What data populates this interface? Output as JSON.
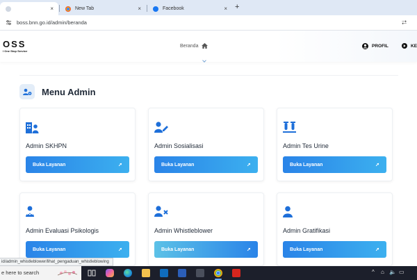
{
  "browser": {
    "tabs": [
      {
        "label": "",
        "close": "×"
      },
      {
        "label": "New Tab",
        "close": "×"
      },
      {
        "label": "Facebook",
        "close": "×"
      }
    ],
    "new_tab": "+",
    "url": "boss.bnn.go.id/admin/beranda"
  },
  "site": {
    "logo": "OSS",
    "logo_sub": "l One Stop Service",
    "nav": {
      "beranda": "Beranda",
      "profil": "PROFIL",
      "keluar": "KE"
    }
  },
  "menu": {
    "title": "Menu Admin",
    "cards": [
      {
        "title": "Admin SKHPN",
        "button": "Buka Layanan",
        "icon": "building-users-icon"
      },
      {
        "title": "Admin Sosialisasi",
        "button": "Buka Layanan",
        "icon": "user-edit-icon"
      },
      {
        "title": "Admin Tes Urine",
        "button": "Buka Layanan",
        "icon": "vials-icon"
      },
      {
        "title": "Admin Evaluasi Psikologis",
        "button": "Buka Layanan",
        "icon": "user-scale-icon"
      },
      {
        "title": "Admin Whistleblower",
        "button": "Buka Layanan",
        "icon": "user-times-icon"
      },
      {
        "title": "Admin Gratifikasi",
        "button": "Buka Layanan",
        "icon": "user-icon"
      }
    ]
  },
  "status_url": "id/admin_whistleblower/lihat_pengaduan_whistleblowing",
  "taskbar": {
    "search_text": "e here to search"
  },
  "colors": {
    "button_gradient_start": "#2a84e8",
    "button_gradient_end": "#3cb0ef",
    "icon_blue": "#1e6fd9",
    "taskbar": "#1c1f2b"
  }
}
